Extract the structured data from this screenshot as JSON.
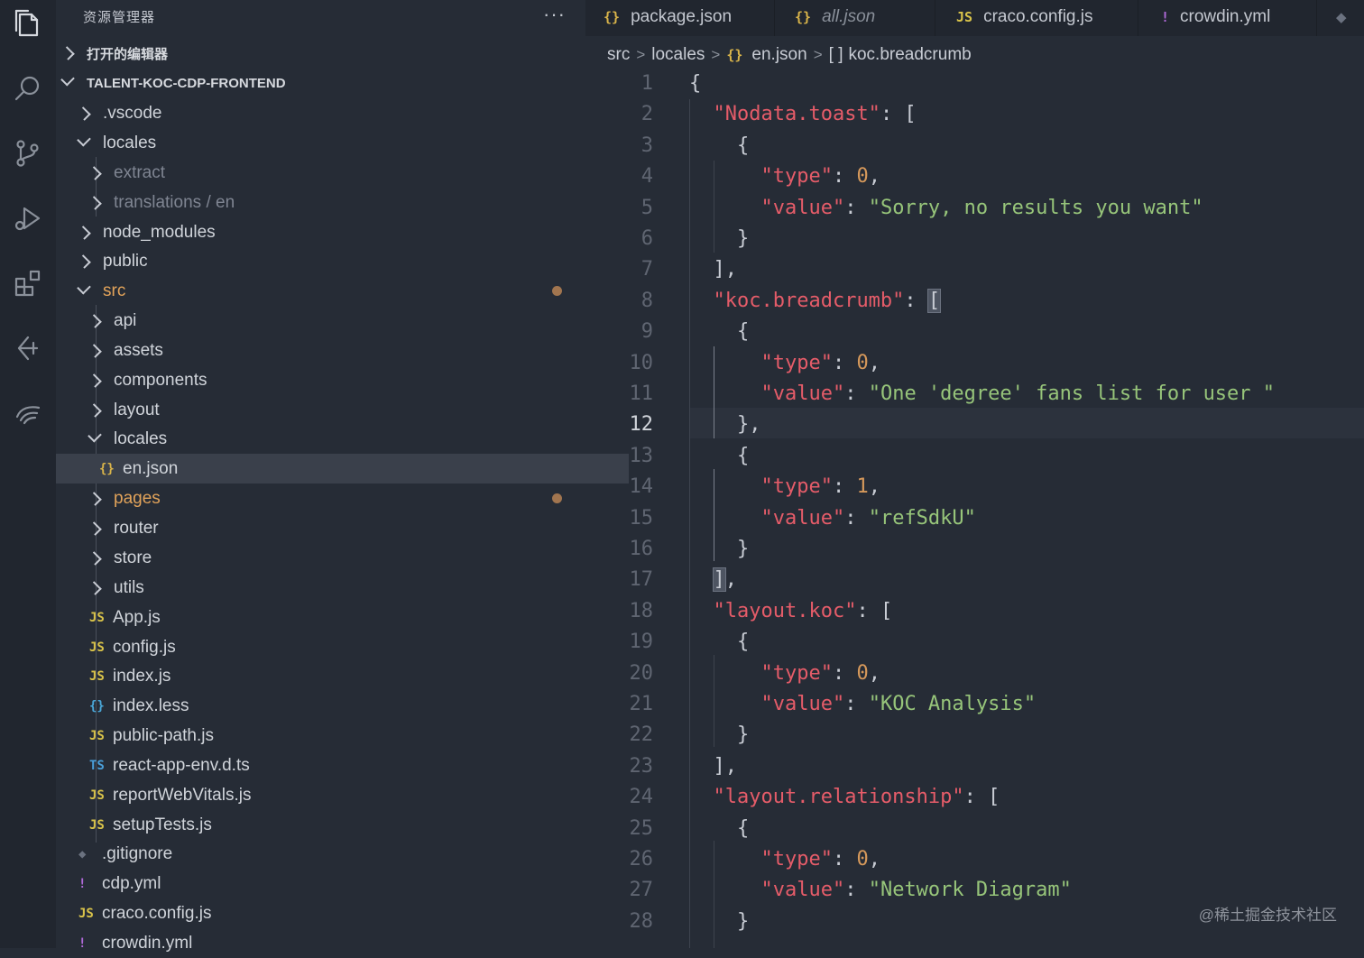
{
  "colors": {
    "keyword_key": "#e55c69",
    "string": "#97c57a",
    "number": "#d6995b",
    "modified": "#e2a35a",
    "background": "#262c36"
  },
  "activity_bar": {
    "icons": [
      "files-icon",
      "search-icon",
      "source-control-icon",
      "run-debug-icon",
      "extensions-icon",
      "remote-icon",
      "extra-icon"
    ]
  },
  "sidebar": {
    "title": "资源管理器",
    "more": "···",
    "open_editors": "打开的编辑器",
    "project": "TALENT-KOC-CDP-FRONTEND",
    "items": [
      {
        "label": ".vscode"
      },
      {
        "label": "locales"
      },
      {
        "label": "extract"
      },
      {
        "label": "translations / en"
      },
      {
        "label": "node_modules"
      },
      {
        "label": "public"
      },
      {
        "label": "src"
      },
      {
        "label": "api"
      },
      {
        "label": "assets"
      },
      {
        "label": "components"
      },
      {
        "label": "layout"
      },
      {
        "label": "locales"
      },
      {
        "label": "en.json",
        "icon": "{}"
      },
      {
        "label": "pages"
      },
      {
        "label": "router"
      },
      {
        "label": "store"
      },
      {
        "label": "utils"
      },
      {
        "label": "App.js",
        "icon": "JS"
      },
      {
        "label": "config.js",
        "icon": "JS"
      },
      {
        "label": "index.js",
        "icon": "JS"
      },
      {
        "label": "index.less",
        "icon": "{}"
      },
      {
        "label": "public-path.js",
        "icon": "JS"
      },
      {
        "label": "react-app-env.d.ts",
        "icon": "TS"
      },
      {
        "label": "reportWebVitals.js",
        "icon": "JS"
      },
      {
        "label": "setupTests.js",
        "icon": "JS"
      },
      {
        "label": ".gitignore",
        "icon": "◆"
      },
      {
        "label": "cdp.yml",
        "icon": "!"
      },
      {
        "label": "craco.config.js",
        "icon": "JS"
      },
      {
        "label": "crowdin.yml",
        "icon": "!"
      }
    ]
  },
  "tabs": [
    {
      "label": "package.json",
      "icon": "{}"
    },
    {
      "label": "all.json",
      "icon": "{}"
    },
    {
      "label": "craco.config.js",
      "icon": "JS"
    },
    {
      "label": "crowdin.yml",
      "icon": "!"
    }
  ],
  "breadcrumb": {
    "src": "src",
    "locales": "locales",
    "file_icon": "{}",
    "file": "en.json",
    "sym_icon": "[ ]",
    "symbol": "koc.breadcrumb"
  },
  "editor": {
    "current_line": 12,
    "line_numbers": [
      "1",
      "2",
      "3",
      "4",
      "5",
      "6",
      "7",
      "8",
      "9",
      "10",
      "11",
      "12",
      "13",
      "14",
      "15",
      "16",
      "17",
      "18",
      "19",
      "20",
      "21",
      "22",
      "23",
      "24",
      "25",
      "26",
      "27",
      "28"
    ]
  },
  "code": {
    "k_nodata": "\"Nodata.toast\"",
    "k_type": "\"type\"",
    "k_value": "\"value\"",
    "v_sorry": "\"Sorry, no results you want\"",
    "k_koc": "\"koc.breadcrumb\"",
    "v_one": "\"One 'degree' fans list for user \"",
    "v_ref": "\"refSdkU\"",
    "k_layout_koc": "\"layout.koc\"",
    "v_koc_analysis": "\"KOC Analysis\"",
    "k_layout_rel": "\"layout.relationship\"",
    "v_network": "\"Network Diagram\"",
    "n0": "0",
    "n1": "1"
  },
  "watermark": "@稀土掘金技术社区"
}
